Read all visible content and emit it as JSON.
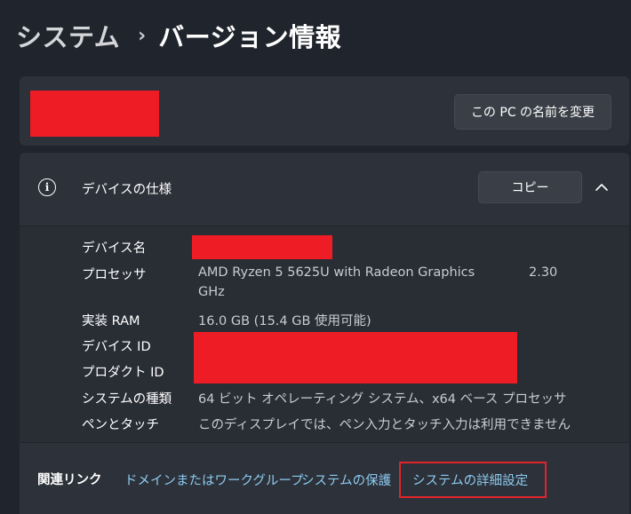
{
  "breadcrumb": {
    "parent": "システム",
    "separator": "›",
    "current": "バージョン情報"
  },
  "device_card": {
    "rename_button": "この PC の名前を変更"
  },
  "specs": {
    "title": "デバイスの仕様",
    "copy_button": "コピー",
    "expanded": true,
    "rows": [
      {
        "label": "デバイス名",
        "value": ""
      },
      {
        "label": "プロセッサ",
        "value_line1": "AMD Ryzen 5 5625U with Radeon Graphics",
        "value_extra": "2.30",
        "value_line2": "GHz"
      },
      {
        "label": "実装 RAM",
        "value": "16.0 GB (15.4 GB 使用可能)"
      },
      {
        "label": "デバイス ID",
        "value": ""
      },
      {
        "label": "プロダクト ID",
        "value": ""
      },
      {
        "label": "システムの種類",
        "value": "64 ビット オペレーティング システム、x64 ベース プロセッサ"
      },
      {
        "label": "ペンとタッチ",
        "value": "このディスプレイでは、ペン入力とタッチ入力は利用できません"
      }
    ]
  },
  "related": {
    "label": "関連リンク",
    "links": [
      {
        "label": "ドメインまたはワークグループ"
      },
      {
        "label": "システムの保護"
      },
      {
        "label": "システムの詳細設定",
        "highlighted": true
      }
    ]
  },
  "colors": {
    "background": "#20242c",
    "card": "#2d3139",
    "link": "#8ccaf0",
    "redaction": "#ee1c25",
    "highlight": "#e3242b"
  }
}
